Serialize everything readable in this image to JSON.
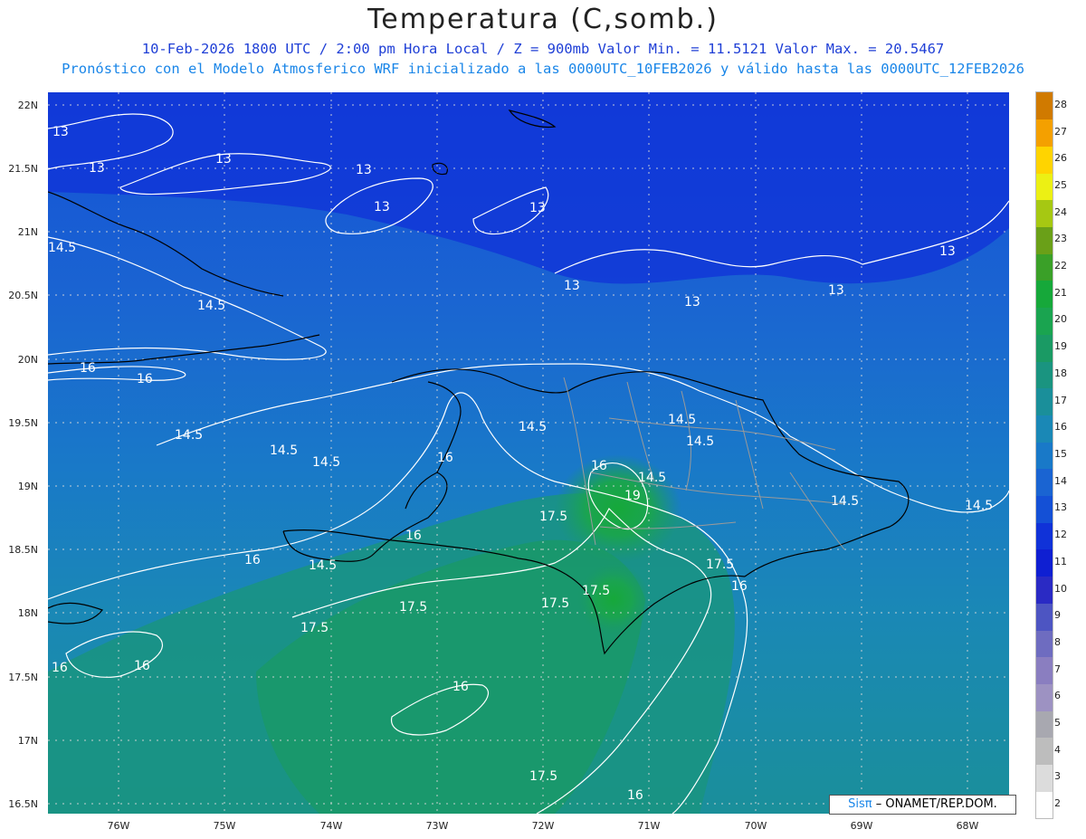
{
  "title": "Temperatura (C,somb.)",
  "subtitle_1": "10-Feb-2026  1800 UTC / 2:00 pm Hora Local / Z = 900mb    Valor Min. = 11.5121  Valor Max. = 20.5467",
  "subtitle_2": "Pronóstico con el Modelo Atmosferico WRF inicializado a las 0000UTC_10FEB2026 y válido hasta las  0000UTC_12FEB2026",
  "lat_labels": [
    "22N",
    "21.5N",
    "21N",
    "20.5N",
    "20N",
    "19.5N",
    "19N",
    "18.5N",
    "18N",
    "17.5N",
    "17N",
    "16.5N"
  ],
  "lon_labels": [
    "76W",
    "75W",
    "74W",
    "73W",
    "72W",
    "71W",
    "70W",
    "69W",
    "68W"
  ],
  "colorbar": {
    "labels": [
      "2",
      "3",
      "4",
      "5",
      "6",
      "7",
      "8",
      "9",
      "10",
      "11",
      "12",
      "13",
      "14",
      "15",
      "16",
      "17",
      "18",
      "19",
      "20",
      "21",
      "22",
      "23",
      "24",
      "25",
      "26",
      "27",
      "28"
    ],
    "colors": [
      "#ffffff",
      "#dcdcdc",
      "#bdbdbd",
      "#a8a8b0",
      "#9d92c2",
      "#8a7ec0",
      "#6e6cc0",
      "#4d55c2",
      "#2a2ac4",
      "#0f1fd2",
      "#1032d8",
      "#1450d6",
      "#1a64d2",
      "#1979c8",
      "#1a88b6",
      "#1a8f9a",
      "#1a9480",
      "#1a9a64",
      "#1aa450",
      "#16a83a",
      "#3aa028",
      "#6aa018",
      "#a6c812",
      "#ecf014",
      "#ffd400",
      "#f4a000",
      "#d07a00"
    ]
  },
  "contour_labels": [
    "13",
    "14.5",
    "16",
    "17.5",
    "19"
  ],
  "colors": {
    "coast": "#000000",
    "borders": "#9a9a9a",
    "contour": "#ffffff",
    "title_line_1": "#1f3fd6",
    "title_line_2": "#1a86e8"
  },
  "logo": {
    "brand": "Sisπ",
    "rest": "– ONAMET/REP.DOM."
  }
}
